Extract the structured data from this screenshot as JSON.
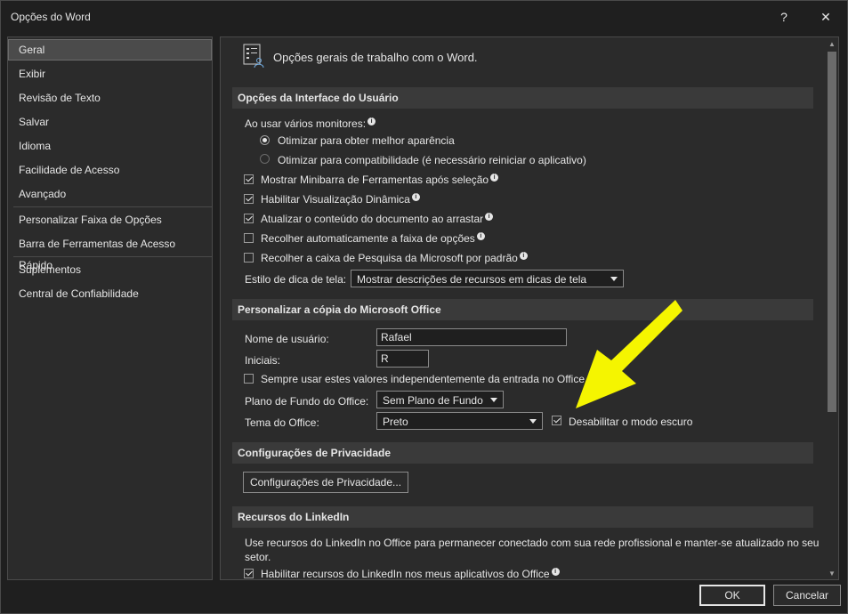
{
  "window": {
    "title": "Opções do Word",
    "help_label": "?",
    "close_label": "✕"
  },
  "sidebar": {
    "items": [
      {
        "label": "Geral"
      },
      {
        "label": "Exibir"
      },
      {
        "label": "Revisão de Texto"
      },
      {
        "label": "Salvar"
      },
      {
        "label": "Idioma"
      },
      {
        "label": "Facilidade de Acesso"
      },
      {
        "label": "Avançado"
      },
      {
        "label": "Personalizar Faixa de Opções"
      },
      {
        "label": "Barra de Ferramentas de Acesso Rápido"
      },
      {
        "label": "Suplementos"
      },
      {
        "label": "Central de Confiabilidade"
      }
    ]
  },
  "header": {
    "title": "Opções gerais de trabalho com o Word."
  },
  "ui_section": {
    "title": "Opções da Interface do Usuário",
    "monitors_label": "Ao usar vários monitores:",
    "radio_best": "Otimizar para obter melhor aparência",
    "radio_compat": "Otimizar para compatibilidade (é necessário reiniciar o aplicativo)",
    "check_minibar": "Mostrar Minibarra de Ferramentas após seleção",
    "check_live_preview": "Habilitar Visualização Dinâmica",
    "check_update_drag": "Atualizar o conteúdo do documento ao arrastar",
    "check_collapse_ribbon": "Recolher automaticamente a faixa de opções",
    "check_collapse_search": "Recolher a caixa de Pesquisa da Microsoft por padrão",
    "screentip_label": "Estilo de dica de tela:",
    "screentip_value": "Mostrar descrições de recursos em dicas de tela"
  },
  "personalize_section": {
    "title": "Personalizar a cópia do Microsoft Office",
    "username_label": "Nome de usuário:",
    "username_value": "Rafael",
    "initials_label": "Iniciais:",
    "initials_value": "R",
    "always_use_label": "Sempre usar estes valores independentemente da entrada no Office.",
    "background_label": "Plano de Fundo do Office:",
    "background_value": "Sem Plano de Fundo",
    "theme_label": "Tema do Office:",
    "theme_value": "Preto",
    "disable_dark_label": "Desabilitar o modo escuro"
  },
  "privacy_section": {
    "title": "Configurações de Privacidade",
    "button_label": "Configurações de Privacidade..."
  },
  "linkedin_section": {
    "title": "Recursos do LinkedIn",
    "description_line1": "Use recursos do LinkedIn no Office para permanecer conectado com sua rede profissional e manter-se atualizado no seu",
    "description_line2": "setor.",
    "check_label": "Habilitar recursos do LinkedIn nos meus aplicativos do Office"
  },
  "footer": {
    "ok_label": "OK",
    "cancel_label": "Cancelar"
  },
  "colors": {
    "annotation_arrow": "#f5f500",
    "dialog_bg": "#1f1f1f",
    "panel_bg": "#2b2b2b"
  }
}
